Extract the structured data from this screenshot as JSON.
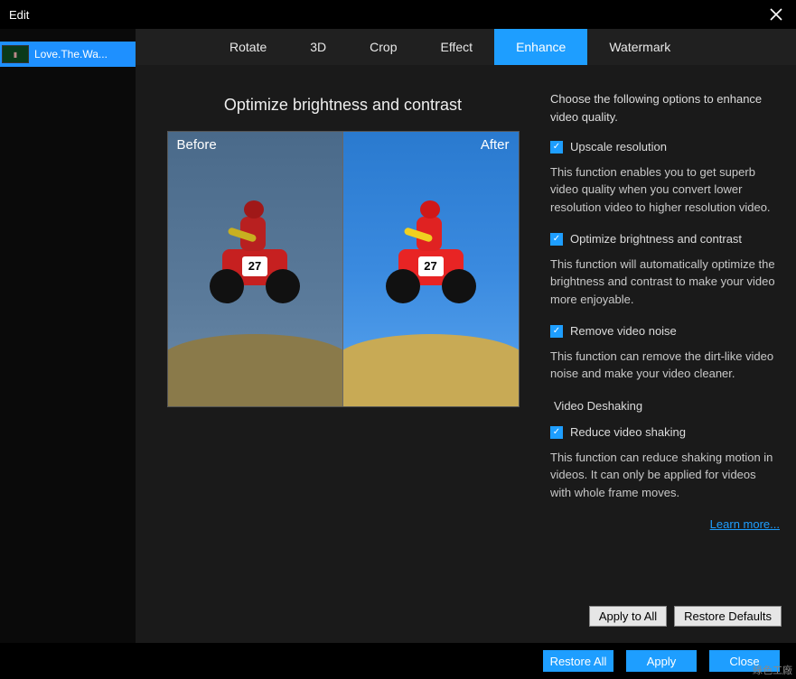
{
  "titlebar": {
    "title": "Edit"
  },
  "file": {
    "name": "Love.The.Wa..."
  },
  "tabs": [
    {
      "label": "Rotate"
    },
    {
      "label": "3D"
    },
    {
      "label": "Crop"
    },
    {
      "label": "Effect"
    },
    {
      "label": "Enhance"
    },
    {
      "label": "Watermark"
    }
  ],
  "preview": {
    "heading": "Optimize brightness and contrast",
    "before": "Before",
    "after": "After",
    "number": "27"
  },
  "options": {
    "intro": "Choose the following options to enhance video quality.",
    "upscale": {
      "label": "Upscale resolution",
      "desc": "This function enables you to get superb video quality when you convert lower resolution video to higher resolution video."
    },
    "optimize": {
      "label": "Optimize brightness and contrast",
      "desc": "This function will automatically optimize the brightness and contrast to make your video more enjoyable."
    },
    "noise": {
      "label": "Remove video noise",
      "desc": "This function can remove the dirt-like video noise and make your video cleaner."
    },
    "deshake_header": "Video Deshaking",
    "reduce": {
      "label": "Reduce video shaking",
      "desc": "This function can reduce shaking motion in videos. It can only be applied for videos with whole frame moves."
    },
    "learn": "Learn more..."
  },
  "buttons": {
    "apply_all": "Apply to All",
    "restore_defaults": "Restore Defaults",
    "restore_all": "Restore All",
    "apply": "Apply",
    "close": "Close"
  },
  "watermark": "綠色工廠"
}
